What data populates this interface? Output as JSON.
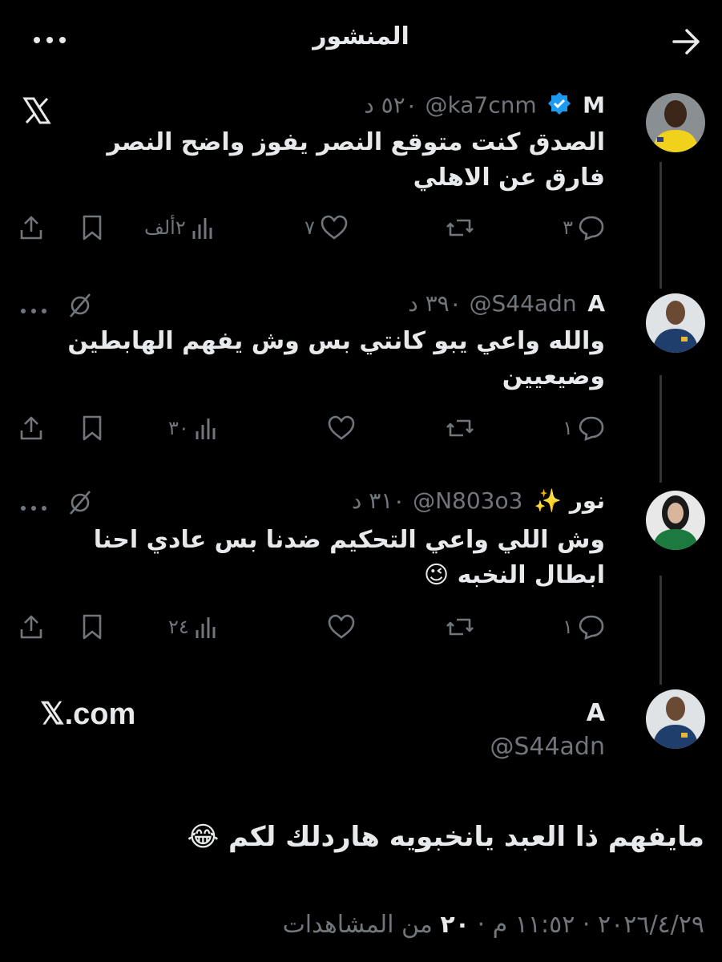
{
  "header": {
    "title": "المنشور",
    "back_icon": "arrow-right-icon",
    "more_icon": "more-horizontal-icon"
  },
  "colors": {
    "background": "#000000",
    "text": "#e7e9ea",
    "muted": "#71767b",
    "verified": "#1d9bf0",
    "line": "#333639"
  },
  "replies": [
    {
      "name": "M",
      "verified": true,
      "handle": "@ka7cnm",
      "time": "٥٢٠ د",
      "text_line1": "الصدق كنت متوقع النصر يفوز واضح النصر",
      "text_line2": "فارق عن الاهلي",
      "corner_icon": "x-logo-icon",
      "actions": {
        "reply": "٣",
        "retweet": "",
        "like": "٧",
        "views": "٢ألف"
      }
    },
    {
      "name": "A",
      "verified": false,
      "handle": "@S44adn",
      "time": "٣٩٠ د",
      "text_line1": "والله واعي يبو كانتي بس وش يفهم الهابطين",
      "text_line2": "وضيعيين",
      "corner_icon": "grok-icon",
      "actions": {
        "reply": "١",
        "retweet": "",
        "like": "",
        "views": "٣٠"
      }
    },
    {
      "name": "نور ✨",
      "verified": false,
      "handle": "@N803o3",
      "time": "٣١٠ د",
      "text_line1": "وش اللي واعي التحكيم ضدنا بس عادي احنا",
      "text_line2": "ابطال النخبه 😉",
      "corner_icon": "grok-icon",
      "actions": {
        "reply": "١",
        "retweet": "",
        "like": "",
        "views": "٢٤"
      }
    }
  ],
  "main_post": {
    "name": "A",
    "handle": "@S44adn",
    "card_domain": "𝕏.com",
    "text": "مايفهم ذا العبد يانخبويه هاردلك لكم 😂",
    "date": "٢٠٢٦/٤/٢٩",
    "time": "١١:٥٢ م",
    "views_count": "٢٠",
    "views_label": "من المشاهدات"
  }
}
